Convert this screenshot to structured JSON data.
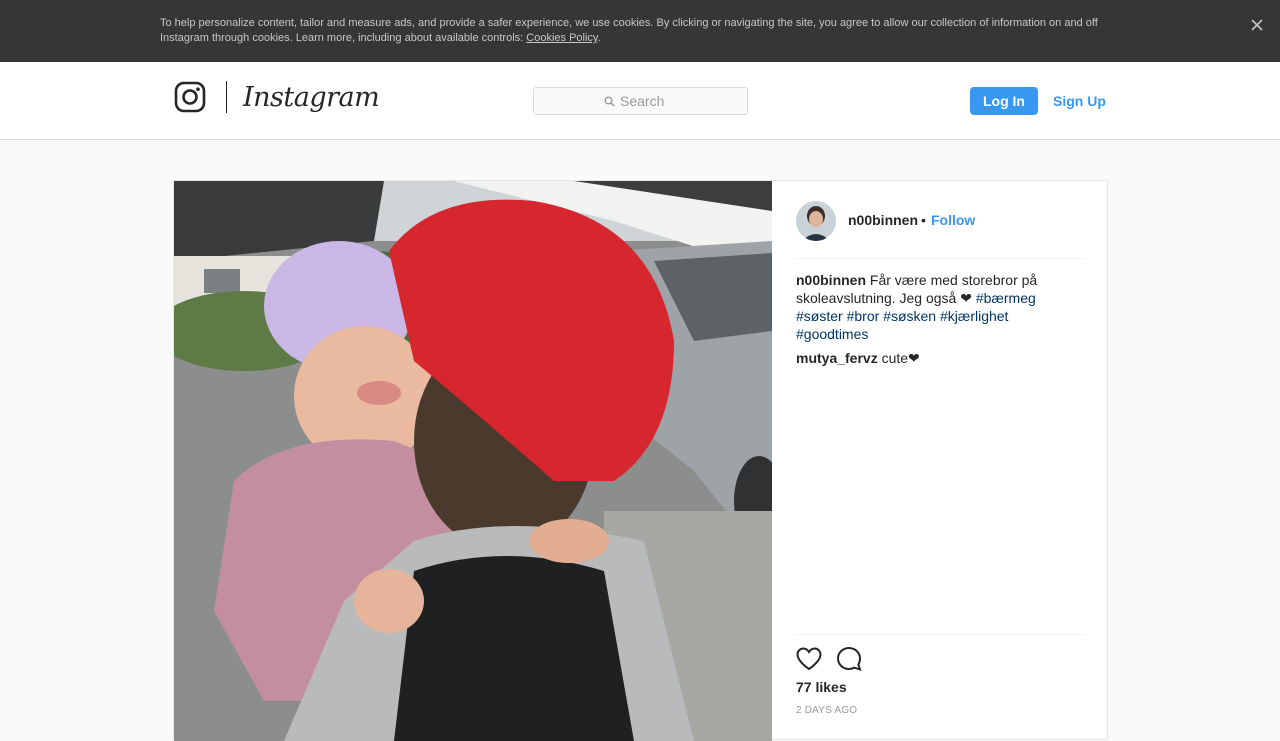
{
  "cookie_banner": {
    "text": "To help personalize content, tailor and measure ads, and provide a safer experience, we use cookies. By clicking or navigating the site, you agree to allow our collection of information on and off Instagram through cookies. Learn more, including about available controls: ",
    "link_label": "Cookies Policy",
    "trailing": ".",
    "close_icon": "close-icon"
  },
  "header": {
    "logo_icon": "instagram-glyph-icon",
    "wordmark": "Instagram",
    "search": {
      "placeholder": "Search",
      "icon": "search-icon",
      "value": ""
    },
    "login_label": "Log In",
    "signup_label": "Sign Up"
  },
  "post": {
    "author": "n00binnen",
    "separator": "•",
    "follow_label": "Follow",
    "caption": {
      "user": "n00binnen",
      "text": "Får være med storebror på skoleavslutning. Jeg også ❤ ",
      "hashtags": [
        "#bærmeg",
        "#søster",
        "#bror",
        "#søsken",
        "#kjærlighet",
        "#goodtimes"
      ]
    },
    "comments": [
      {
        "user": "mutya_fervz",
        "text": "cute❤"
      }
    ],
    "likes": "77 likes",
    "timestamp": "2 DAYS AGO"
  },
  "colors": {
    "accent": "#3897f0",
    "hashtag": "#003569",
    "banner_bg": "#363636",
    "page_bg": "#fafafa"
  }
}
